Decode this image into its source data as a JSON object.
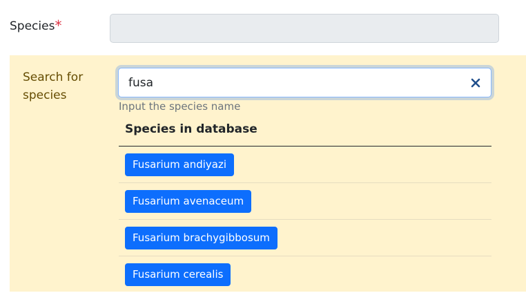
{
  "species": {
    "label": "Species",
    "required_mark": "*",
    "value": ""
  },
  "search": {
    "label": "Search for species",
    "value": "fusa",
    "help_text": "Input the species name",
    "clear_icon": "close-icon"
  },
  "results": {
    "heading": "Species in database",
    "items": [
      {
        "label": "Fusarium andiyazi"
      },
      {
        "label": "Fusarium avenaceum"
      },
      {
        "label": "Fusarium brachygibbosum"
      },
      {
        "label": "Fusarium cerealis"
      }
    ]
  },
  "colors": {
    "panel_bg": "#fff3cd",
    "panel_text": "#664d03",
    "button_bg": "#0d6efd",
    "button_text": "#ffffff",
    "required": "#dc3545",
    "clear_icon": "#1f4e8c"
  }
}
